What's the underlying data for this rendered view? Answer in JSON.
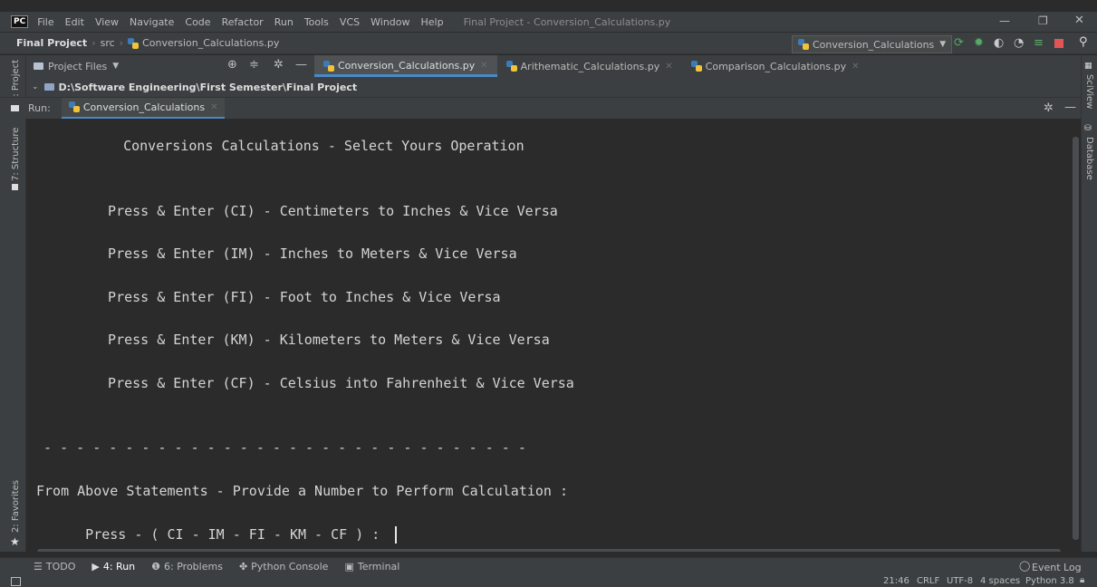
{
  "menubar": {
    "app_badge": "PC",
    "items": [
      "File",
      "Edit",
      "View",
      "Navigate",
      "Code",
      "Refactor",
      "Run",
      "Tools",
      "VCS",
      "Window",
      "Help"
    ],
    "window_title": "Final Project - Conversion_Calculations.py"
  },
  "navbar": {
    "project": "Final Project",
    "folder": "src",
    "file": "Conversion_Calculations.py",
    "run_config": "Conversion_Calculations"
  },
  "project_panel": {
    "dropdown": "Project Files",
    "path": "D:\\Software Engineering\\First Semester\\Final Project"
  },
  "editor_tabs": [
    "Conversion_Calculations.py",
    "Arithematic_Calculations.py",
    "Comparison_Calculations.py"
  ],
  "run_panel": {
    "label": "Run:",
    "tab": "Conversion_Calculations"
  },
  "console": {
    "lines": [
      "   Conversions Calculations - Select Yours Operation",
      "  Press & Enter (CI) - Centimeters to Inches & Vice Versa",
      "  Press & Enter (IM) - Inches to Meters & Vice Versa",
      "  Press & Enter (FI) - Foot to Inches & Vice Versa",
      "  Press & Enter (KM) - Kilometers to Meters & Vice Versa",
      "  Press & Enter (CF) - Celsius into Fahrenheit & Vice Versa",
      " - - - - - - - - - - - - - - - - - - - - - - - - - - - - - -",
      "From Above Statements - Provide a Number to Perform Calculation :",
      "      Press - ( CI - IM - FI - KM - CF ) : "
    ]
  },
  "left_strip": {
    "project": "1: Project",
    "structure": "7: Structure",
    "favorites": "2: Favorites"
  },
  "right_strip": {
    "sciview": "SciView",
    "database": "Database"
  },
  "bottom_tabs": {
    "todo": "TODO",
    "run": "4: Run",
    "problems": "6: Problems",
    "python_console": "Python Console",
    "terminal": "Terminal",
    "event_log": "Event Log"
  },
  "statusbar": {
    "position": "21:46",
    "line_sep": "CRLF",
    "encoding": "UTF-8",
    "indent": "4 spaces",
    "interpreter": "Python 3.8"
  },
  "colors": {
    "background": "#2b2b2b",
    "console_bg": "#2b2b2b",
    "panel_bg": "#3c3f41",
    "accent": "#4a88c7"
  }
}
